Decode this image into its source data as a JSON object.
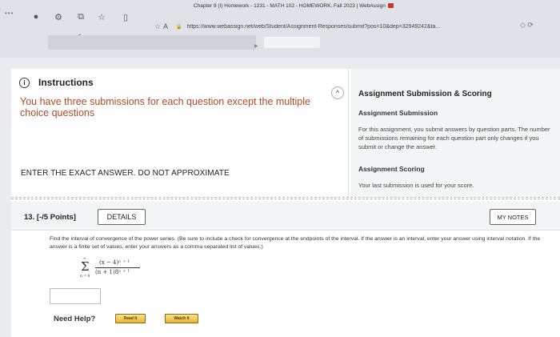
{
  "browser": {
    "tab_title": "Chapter 9 (I) Homework - 1231 - MATH 102 - HOMEWORK, Fall 2023 | WebAssign",
    "address_prefix": "A",
    "url": "https://www.webassign.net/web/Student/Assignment-Responses/submit?pos=10&dep=32949242&ta...",
    "window_controls": "•••"
  },
  "instructions": {
    "title": "Instructions",
    "info_glyph": "i",
    "collapse_glyph": "^",
    "text": "You have three submissions for each question except the multiple choice questions",
    "exact_answer": "ENTER THE EXACT ANSWER. DO NOT APPROXIMATE"
  },
  "scoring": {
    "title": "Assignment Submission & Scoring",
    "submission_heading": "Assignment Submission",
    "submission_text": "For this assignment, you submit answers by question parts. The number of submissions remaining for each question part only changes if you submit or change the answer.",
    "scoring_heading": "Assignment Scoring",
    "scoring_text": "Your last submission is used for your score."
  },
  "question": {
    "number_label": "13. [-/5 Points]",
    "details_label": "DETAILS",
    "my_notes_label": "MY NOTES",
    "prompt": "Find the interval of convergence of the power series. (Be sure to include a check for convergence at the endpoints of the interval. If the answer is an interval, enter your answer using interval notation. If the answer is a finite set of values, enter your answers as a comma separated list of values.)",
    "formula": {
      "upper_limit": "∞",
      "sigma": "Σ",
      "lower_limit": "n = 0",
      "numerator": "(x − 4)ⁿ ⁺ ¹",
      "denominator": "(n + 1)8ⁿ ⁺ ¹"
    },
    "answer_value": "",
    "need_help_label": "Need Help?",
    "read_it_label": "Read It",
    "watch_it_label": "Watch It"
  },
  "colors": {
    "instruction_text": "#b04a2a",
    "help_button": "#f3c744"
  }
}
